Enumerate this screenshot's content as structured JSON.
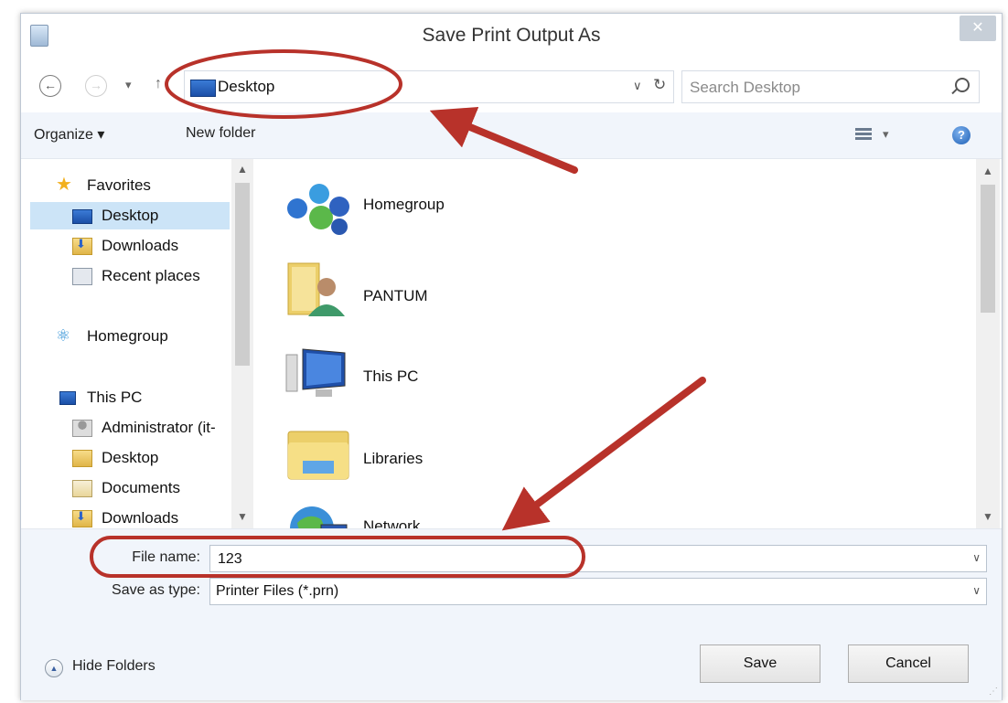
{
  "window": {
    "title": "Save Print Output As",
    "close_glyph": "✕"
  },
  "nav": {
    "back_glyph": "←",
    "forward_glyph": "→",
    "recent_glyph": "▾",
    "up_glyph": "↑",
    "address": "Desktop",
    "address_dropdown_glyph": "∨",
    "refresh_glyph": "↻",
    "search_placeholder": "Search Desktop"
  },
  "toolbar": {
    "organize": "Organize ▾",
    "new_folder": "New folder",
    "view_dropdown_glyph": "▾",
    "help_glyph": "?"
  },
  "sidebar": {
    "items": [
      {
        "label": "Favorites",
        "icon": "star-icon"
      },
      {
        "label": "Desktop",
        "icon": "desktop-icon",
        "selected": true
      },
      {
        "label": "Downloads",
        "icon": "downloads-folder-icon"
      },
      {
        "label": "Recent places",
        "icon": "recent-places-icon"
      },
      {
        "label": "Homegroup",
        "icon": "homegroup-icon"
      },
      {
        "label": "This PC",
        "icon": "computer-icon"
      },
      {
        "label": "Administrator (it-",
        "icon": "user-icon"
      },
      {
        "label": "Desktop",
        "icon": "folder-icon"
      },
      {
        "label": "Documents",
        "icon": "documents-icon"
      },
      {
        "label": "Downloads",
        "icon": "downloads-folder-icon"
      }
    ]
  },
  "files": [
    {
      "name": "Homegroup",
      "icon": "homegroup-icon"
    },
    {
      "name": "PANTUM",
      "icon": "user-folder-icon"
    },
    {
      "name": "This PC",
      "icon": "computer-icon"
    },
    {
      "name": "Libraries",
      "icon": "libraries-icon"
    },
    {
      "name": "Network",
      "icon": "network-icon"
    }
  ],
  "form": {
    "file_name_label": "File name:",
    "file_name_value": "123",
    "save_as_type_label": "Save as type:",
    "save_as_type_value": "Printer Files (*.prn)",
    "dropdown_glyph": "∨"
  },
  "footer": {
    "hide_folders": "Hide Folders",
    "save": "Save",
    "cancel": "Cancel"
  },
  "annotation_color": "#b8322a"
}
